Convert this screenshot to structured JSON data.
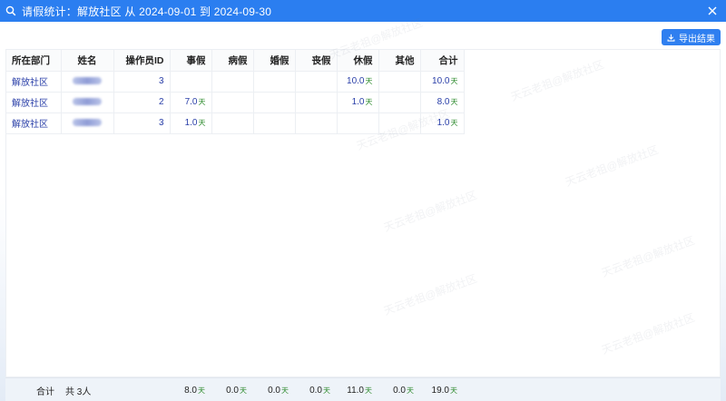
{
  "title": "请假统计：解放社区 从 2024-09-01 到 2024-09-30",
  "export_label": "导出结果",
  "unit": "天",
  "columns": [
    "所在部门",
    "姓名",
    "操作员ID",
    "事假",
    "病假",
    "婚假",
    "丧假",
    "休假",
    "其他",
    "合计"
  ],
  "rows": [
    {
      "dept": "解放社区",
      "opid": "3",
      "shi": "",
      "bing": "",
      "hun": "",
      "sang": "",
      "xiu": "10.0",
      "qita": "",
      "total": "10.0"
    },
    {
      "dept": "解放社区",
      "opid": "2",
      "shi": "7.0",
      "bing": "",
      "hun": "",
      "sang": "",
      "xiu": "1.0",
      "qita": "",
      "total": "8.0"
    },
    {
      "dept": "解放社区",
      "opid": "3",
      "shi": "1.0",
      "bing": "",
      "hun": "",
      "sang": "",
      "xiu": "",
      "qita": "",
      "total": "1.0"
    }
  ],
  "footer": {
    "label": "合计",
    "count": "共 3人",
    "shi": "8.0",
    "bing": "0.0",
    "hun": "0.0",
    "sang": "0.0",
    "xiu": "11.0",
    "qita": "0.0",
    "total": "19.0"
  },
  "watermark_text": "天云老祖@解放社区",
  "colors": {
    "titlebar": "#2b7ef0",
    "link": "#2a3fa8",
    "unit": "#2e8b2e"
  }
}
